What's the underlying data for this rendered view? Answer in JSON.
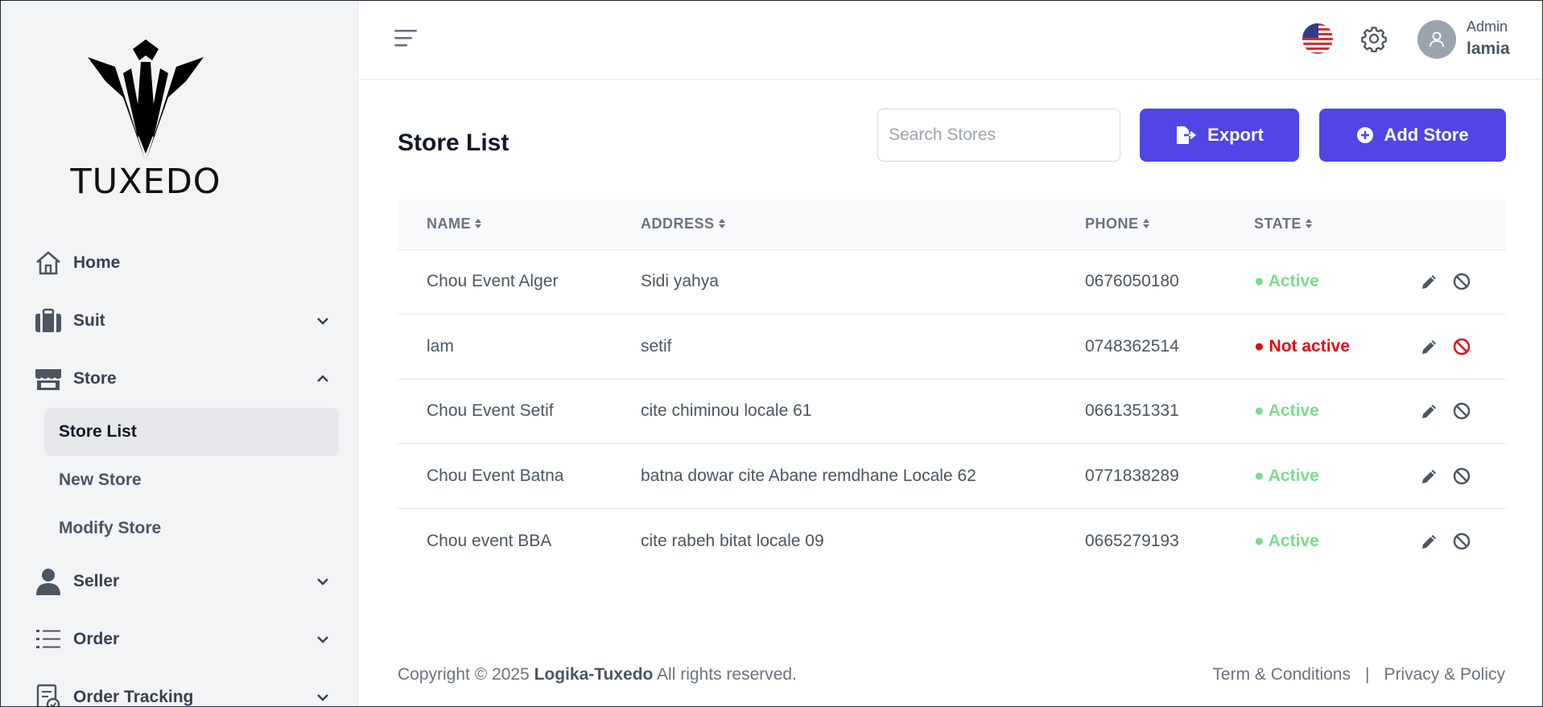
{
  "brand": {
    "name": "TUXEDO"
  },
  "sidebar": {
    "items": [
      {
        "label": "Home",
        "icon": "home-icon",
        "expandable": false
      },
      {
        "label": "Suit",
        "icon": "suitcase-icon",
        "expandable": true,
        "expanded": false
      },
      {
        "label": "Store",
        "icon": "store-icon",
        "expandable": true,
        "expanded": true,
        "children": [
          {
            "label": "Store List",
            "active": true
          },
          {
            "label": "New Store",
            "active": false
          },
          {
            "label": "Modify Store",
            "active": false
          }
        ]
      },
      {
        "label": "Seller",
        "icon": "user-icon",
        "expandable": true,
        "expanded": false
      },
      {
        "label": "Order",
        "icon": "list-icon",
        "expandable": true,
        "expanded": false
      },
      {
        "label": "Order Tracking",
        "icon": "order-tracking-icon",
        "expandable": true,
        "expanded": false
      }
    ]
  },
  "header": {
    "user": {
      "role": "Admin",
      "name": "lamia"
    },
    "language_icon": "us-flag-icon",
    "settings_icon": "gear-icon"
  },
  "main": {
    "title": "Store List",
    "search": {
      "placeholder": "Search Stores",
      "value": ""
    },
    "export_label": "Export",
    "add_label": "Add Store",
    "table": {
      "columns": [
        "NAME",
        "ADDRESS",
        "PHONE",
        "STATE"
      ],
      "rows": [
        {
          "name": "Chou Event Alger",
          "address": "Sidi yahya",
          "phone": "0676050180",
          "state": "Active",
          "active": true
        },
        {
          "name": "lam",
          "address": "setif",
          "phone": "0748362514",
          "state": "Not active",
          "active": false
        },
        {
          "name": "Chou Event Setif",
          "address": "cite chiminou locale 61",
          "phone": "0661351331",
          "state": "Active",
          "active": true
        },
        {
          "name": "Chou Event Batna",
          "address": "batna dowar cite Abane remdhane Locale 62",
          "phone": "0771838289",
          "state": "Active",
          "active": true
        },
        {
          "name": "Chou event BBA",
          "address": "cite rabeh bitat locale 09",
          "phone": "0665279193",
          "state": "Active",
          "active": true
        }
      ]
    }
  },
  "footer": {
    "copyright_prefix": "Copyright © 2025",
    "company": "Logika-Tuxedo",
    "copyright_suffix": "All rights reserved.",
    "terms": "Term & Conditions",
    "privacy": "Privacy & Policy"
  },
  "colors": {
    "accent": "#4f46e5",
    "active": "#7ddc8f",
    "inactive": "#e50914"
  }
}
